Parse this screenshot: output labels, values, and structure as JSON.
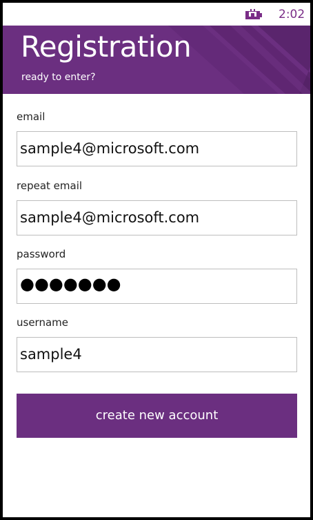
{
  "status_bar": {
    "battery_icon": "battery-charging-icon",
    "time": "2:02",
    "accent": "#7a2d87"
  },
  "header": {
    "title": "Registration",
    "subtitle": "ready to enter?",
    "background": "#6b2f80"
  },
  "form": {
    "email": {
      "label": "email",
      "value": "sample4@microsoft.com"
    },
    "repeat_email": {
      "label": "repeat email",
      "value": "sample4@microsoft.com"
    },
    "password": {
      "label": "password",
      "value": "●●●●●●●"
    },
    "username": {
      "label": "username",
      "value": "sample4"
    }
  },
  "actions": {
    "create_label": "create new account",
    "button_color": "#6b2f80"
  }
}
